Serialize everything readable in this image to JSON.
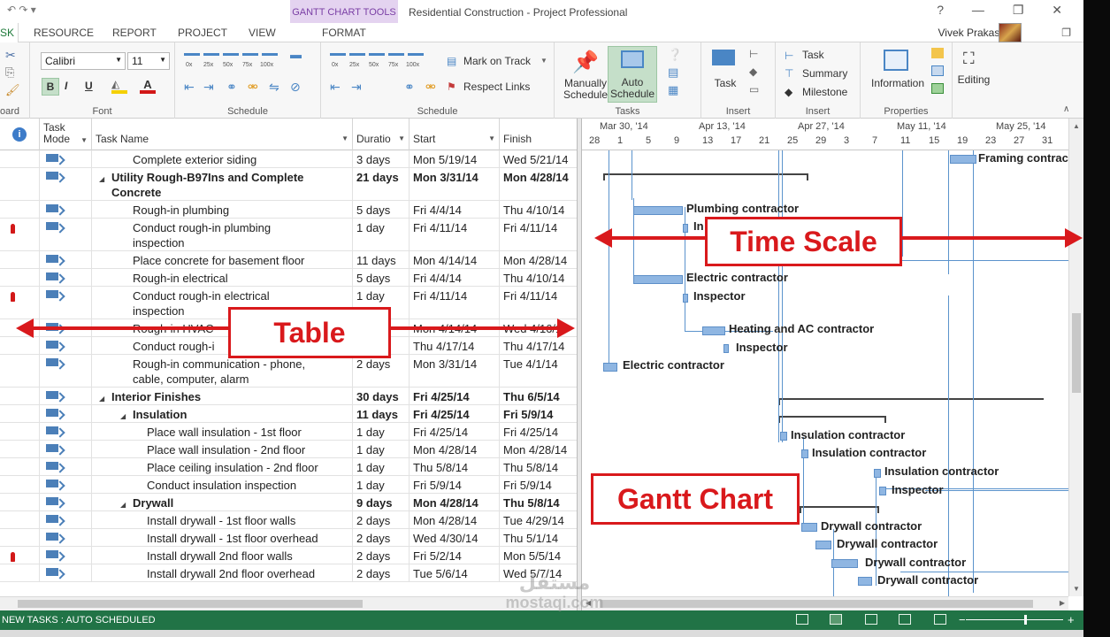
{
  "window": {
    "title": "Residential Construction - Project Professional",
    "contextual_tab_group": "GANTT CHART TOOLS",
    "help": "?",
    "minimize": "—",
    "maximize": "❐",
    "close": "✕",
    "user": "Vivek Prakash"
  },
  "tabs": {
    "active": "SK",
    "items": [
      "RESOURCE",
      "REPORT",
      "PROJECT",
      "VIEW",
      "FORMAT"
    ]
  },
  "ribbon": {
    "clipboard_label": "oard",
    "font": {
      "family": "Calibri",
      "size": "11",
      "bold": "B",
      "italic": "I",
      "underline": "U",
      "label": "Font"
    },
    "schedule": {
      "label": "Schedule",
      "mark_on_track": "Mark on Track",
      "respect_links": "Respect Links",
      "percent_labels": [
        "0x",
        "25x",
        "50x",
        "75x",
        "100x"
      ]
    },
    "tasks": {
      "label": "Tasks",
      "manually_schedule": [
        "Manually",
        "Schedule"
      ],
      "auto_schedule": [
        "Auto",
        "Schedule"
      ]
    },
    "insert_task": {
      "label": "Insert",
      "task": "Task"
    },
    "insert": {
      "label": "Insert",
      "task": "Task",
      "summary": "Summary",
      "milestone": "Milestone"
    },
    "properties": {
      "label": "Properties",
      "information": "Information"
    },
    "editing": {
      "label": "Editing"
    }
  },
  "table": {
    "headers": {
      "indicators": "i",
      "task_mode": [
        "Task",
        "Mode"
      ],
      "task_name": "Task Name",
      "duration": "Duratio",
      "start": "Start",
      "finish": "Finish"
    },
    "rows": [
      {
        "indent": 2,
        "name": [
          "Complete exterior siding"
        ],
        "duration": "3 days",
        "start": "Mon 5/19/14",
        "finish": "Wed 5/21/14",
        "bold": false,
        "person": false
      },
      {
        "indent": 1,
        "summary": true,
        "name": [
          "Utility Rough-B97Ins and Complete",
          "Concrete"
        ],
        "duration": "21 days",
        "start": "Mon 3/31/14",
        "finish": "Mon 4/28/14",
        "bold": true,
        "person": false
      },
      {
        "indent": 2,
        "name": [
          "Rough-in plumbing"
        ],
        "duration": "5 days",
        "start": "Fri 4/4/14",
        "finish": "Thu 4/10/14",
        "bold": false,
        "person": false
      },
      {
        "indent": 2,
        "name": [
          "Conduct rough-in plumbing",
          "inspection"
        ],
        "duration": "1 day",
        "start": "Fri 4/11/14",
        "finish": "Fri 4/11/14",
        "bold": false,
        "person": true
      },
      {
        "indent": 2,
        "name": [
          "Place concrete for basement floor"
        ],
        "duration": "11 days",
        "start": "Mon 4/14/14",
        "finish": "Mon 4/28/14",
        "bold": false,
        "person": false
      },
      {
        "indent": 2,
        "name": [
          "Rough-in electrical"
        ],
        "duration": "5 days",
        "start": "Fri 4/4/14",
        "finish": "Thu 4/10/14",
        "bold": false,
        "person": false
      },
      {
        "indent": 2,
        "name": [
          "Conduct rough-in electrical",
          "inspection"
        ],
        "duration": "1 day",
        "start": "Fri 4/11/14",
        "finish": "Fri 4/11/14",
        "bold": false,
        "person": true
      },
      {
        "indent": 2,
        "name": [
          "Rough-in HVAC"
        ],
        "duration": "",
        "start": "Mon 4/14/14",
        "finish": "Wed 4/16/14",
        "bold": false,
        "person": false
      },
      {
        "indent": 2,
        "name": [
          "Conduct rough-i"
        ],
        "duration": "",
        "start": "Thu 4/17/14",
        "finish": "Thu 4/17/14",
        "bold": false,
        "person": false
      },
      {
        "indent": 2,
        "name": [
          "Rough-in communication - phone,",
          "cable, computer, alarm"
        ],
        "duration": "2 days",
        "start": "Mon 3/31/14",
        "finish": "Tue 4/1/14",
        "bold": false,
        "person": false
      },
      {
        "indent": 1,
        "summary": true,
        "name": [
          "Interior Finishes"
        ],
        "duration": "30 days",
        "start": "Fri 4/25/14",
        "finish": "Thu 6/5/14",
        "bold": true,
        "person": false
      },
      {
        "indent": 2,
        "summary": true,
        "name": [
          "Insulation"
        ],
        "duration": "11 days",
        "start": "Fri 4/25/14",
        "finish": "Fri 5/9/14",
        "bold": true,
        "person": false
      },
      {
        "indent": 3,
        "name": [
          "Place wall insulation - 1st floor"
        ],
        "duration": "1 day",
        "start": "Fri 4/25/14",
        "finish": "Fri 4/25/14",
        "bold": false,
        "person": false
      },
      {
        "indent": 3,
        "name": [
          "Place wall insulation - 2nd floor"
        ],
        "duration": "1 day",
        "start": "Mon 4/28/14",
        "finish": "Mon 4/28/14",
        "bold": false,
        "person": false
      },
      {
        "indent": 3,
        "name": [
          "Place ceiling insulation - 2nd floor"
        ],
        "duration": "1 day",
        "start": "Thu 5/8/14",
        "finish": "Thu 5/8/14",
        "bold": false,
        "person": false
      },
      {
        "indent": 3,
        "name": [
          "Conduct insulation inspection"
        ],
        "duration": "1 day",
        "start": "Fri 5/9/14",
        "finish": "Fri 5/9/14",
        "bold": false,
        "person": false
      },
      {
        "indent": 2,
        "summary": true,
        "name": [
          "Drywall"
        ],
        "duration": "9 days",
        "start": "Mon 4/28/14",
        "finish": "Thu 5/8/14",
        "bold": true,
        "person": false
      },
      {
        "indent": 3,
        "name": [
          "Install drywall - 1st floor walls"
        ],
        "duration": "2 days",
        "start": "Mon 4/28/14",
        "finish": "Tue 4/29/14",
        "bold": false,
        "person": false
      },
      {
        "indent": 3,
        "name": [
          "Install drywall - 1st floor overhead"
        ],
        "duration": "2 days",
        "start": "Wed 4/30/14",
        "finish": "Thu 5/1/14",
        "bold": false,
        "person": false
      },
      {
        "indent": 3,
        "name": [
          "Install drywall 2nd floor walls"
        ],
        "duration": "2 days",
        "start": "Fri 5/2/14",
        "finish": "Mon 5/5/14",
        "bold": false,
        "person": true
      },
      {
        "indent": 3,
        "name": [
          "Install drywall 2nd floor overhead"
        ],
        "duration": "2 days",
        "start": "Tue 5/6/14",
        "finish": "Wed 5/7/14",
        "bold": false,
        "person": false
      }
    ]
  },
  "timescale": {
    "weeks": [
      "Mar 30, '14",
      "Apr 13, '14",
      "Apr 27, '14",
      "May 11, '14",
      "May 25, '14"
    ],
    "days": [
      "28",
      "1",
      "5",
      "9",
      "13",
      "17",
      "21",
      "25",
      "29",
      "3",
      "7",
      "11",
      "15",
      "19",
      "23",
      "27",
      "31"
    ]
  },
  "gantt": {
    "labels": {
      "framing": "Framing contrac",
      "plumbing": "Plumbing contractor",
      "inspector_partial": "In",
      "contractor_partial": "ctor",
      "electric": "Electric contractor",
      "inspector": "Inspector",
      "hvac": "Heating and AC contractor",
      "electric2": "Electric contractor",
      "insulation": "Insulation contractor",
      "drywall": "Drywall contractor"
    }
  },
  "annotations": {
    "time_scale": "Time Scale",
    "table": "Table",
    "gantt_chart": "Gantt Chart"
  },
  "status": {
    "new_tasks": "NEW TASKS : AUTO SCHEDULED",
    "zoom_minus": "−",
    "zoom_plus": "+"
  },
  "watermark": [
    "مستقل",
    "mostaqi.com"
  ],
  "colors": {
    "accent_green": "#217346",
    "callout_red": "#d9191c",
    "bar_blue": "#8fb6e2",
    "context_purple": "#e4d3f0"
  }
}
